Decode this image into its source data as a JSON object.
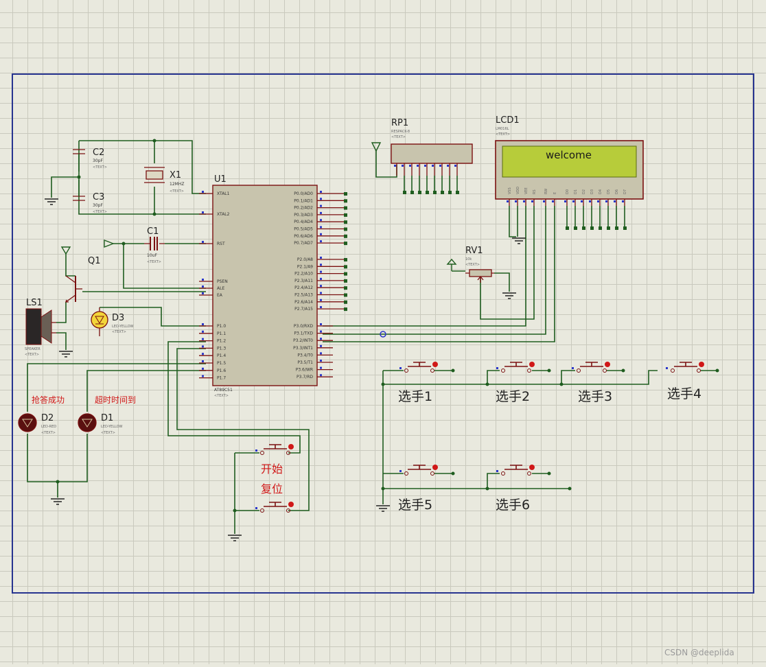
{
  "schematic": {
    "frame_color": "#26338f",
    "wire_color": "#1f5d1f",
    "component_color": "#7a1010",
    "lcd_screen_color": "#b7cc3a",
    "watermark": "CSDN @deeplida"
  },
  "components": {
    "c2": {
      "ref": "C2",
      "value": "30pF",
      "text": "<TEXT>"
    },
    "c3": {
      "ref": "C3",
      "value": "30pF",
      "text": "<TEXT>"
    },
    "x1": {
      "ref": "X1",
      "value": "12MHZ",
      "text": "<TEXT>"
    },
    "c1": {
      "ref": "C1",
      "value": "10uF",
      "text": "<TEXT>"
    },
    "u1": {
      "ref": "U1",
      "part": "AT89C51",
      "text": "<TEXT>",
      "left_pins_top": [
        "XTAL1",
        "XTAL2"
      ],
      "left_pin_rst": "RST",
      "left_pins_ctrl": [
        "PSEN",
        "ALE",
        "EA"
      ],
      "left_pins_p1": [
        "P1.0",
        "P1.1",
        "P1.2",
        "P1.3",
        "P1.4",
        "P1.5",
        "P1.6",
        "P1.7"
      ],
      "right_pins_p0": [
        "P0.0/AD0",
        "P0.1/AD1",
        "P0.2/AD2",
        "P0.3/AD3",
        "P0.4/AD4",
        "P0.5/AD5",
        "P0.6/AD6",
        "P0.7/AD7"
      ],
      "right_pins_p2": [
        "P2.0/A8",
        "P2.1/A9",
        "P2.2/A10",
        "P2.3/A11",
        "P2.4/A12",
        "P2.5/A13",
        "P2.6/A14",
        "P2.7/A15"
      ],
      "right_pins_p3": [
        "P3.0/RXD",
        "P3.1/TXD",
        "P3.2/INT0",
        "P3.3/INT1",
        "P3.4/T0",
        "P3.5/T1",
        "P3.6/WR",
        "P3.7/RD"
      ]
    },
    "q1": {
      "ref": "Q1"
    },
    "ls1": {
      "ref": "LS1",
      "part": "SPEAKER",
      "text": "<TEXT>"
    },
    "d3": {
      "ref": "D3",
      "part": "LED-YELLOW",
      "text": "<TEXT>"
    },
    "d2": {
      "ref": "D2",
      "part": "LED-RED",
      "text": "<TEXT>",
      "caption": "抢答成功"
    },
    "d1": {
      "ref": "D1",
      "part": "LED-YELLOW",
      "text": "<TEXT>",
      "caption": "超时时间到"
    },
    "rp1": {
      "ref": "RP1",
      "part": "RESPACK-8",
      "text": "<TEXT>"
    },
    "lcd1": {
      "ref": "LCD1",
      "part": "LM016L",
      "text": "<TEXT>",
      "display": "welcome",
      "pins": [
        "VSS",
        "VDD",
        "VEE",
        "RS",
        "RW",
        "E",
        "D0",
        "D1",
        "D2",
        "D3",
        "D4",
        "D5",
        "D6",
        "D7"
      ]
    },
    "rv1": {
      "ref": "RV1",
      "value": "10k",
      "text": "<TEXT>"
    }
  },
  "buttons": {
    "start": "开始",
    "reset": "复位",
    "players": [
      "选手1",
      "选手2",
      "选手3",
      "选手4",
      "选手5",
      "选手6"
    ]
  }
}
